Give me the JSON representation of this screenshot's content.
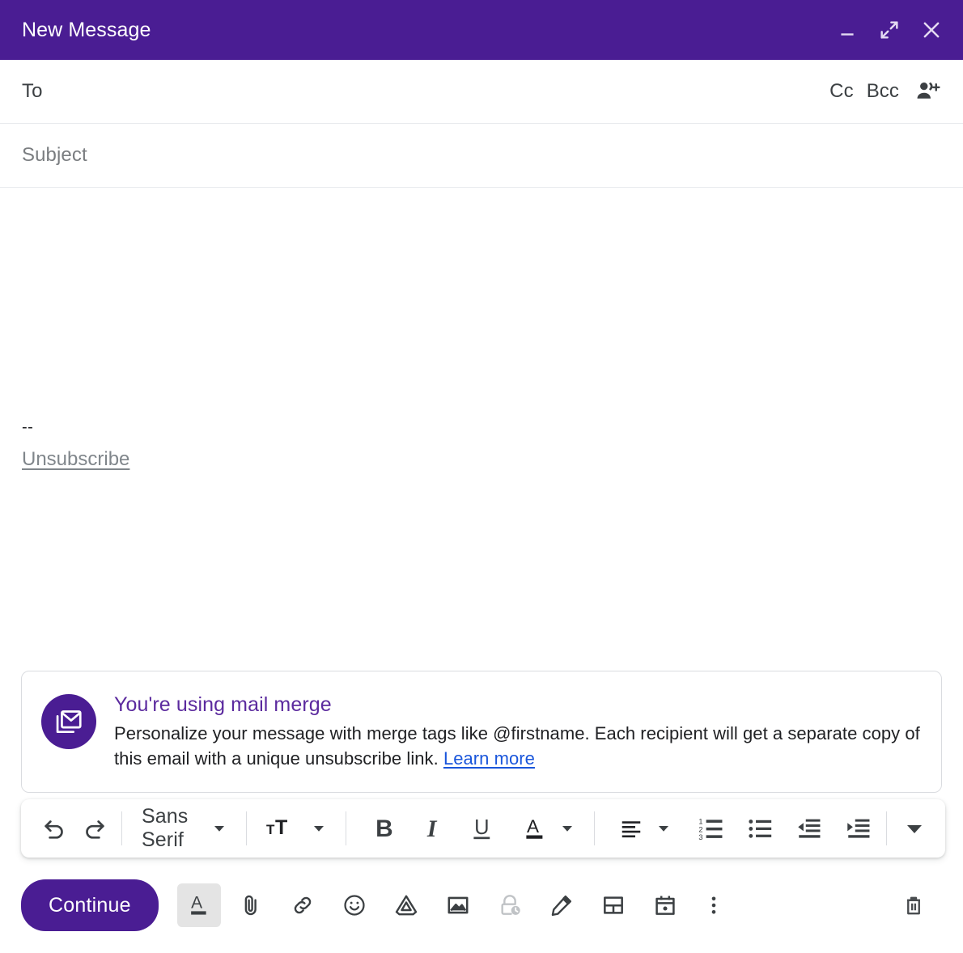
{
  "window": {
    "title": "New Message",
    "controls": [
      {
        "name": "minimize-button",
        "icon": "minimize-icon",
        "label": "Minimize"
      },
      {
        "name": "expand-button",
        "icon": "expand-icon",
        "label": "Full screen"
      },
      {
        "name": "close-button",
        "icon": "close-icon",
        "label": "Save & close"
      }
    ]
  },
  "fields": {
    "to": {
      "label": "To",
      "value": "",
      "placeholder": "To"
    },
    "cc": {
      "label": "Cc"
    },
    "bcc": {
      "label": "Bcc"
    },
    "add_people": {
      "icon": "add-people-icon"
    },
    "subject": {
      "label": "Subject",
      "value": "",
      "placeholder": "Subject"
    }
  },
  "body": {
    "content": "",
    "signature_separator": "--",
    "unsubscribe_label": "Unsubscribe"
  },
  "merge_banner": {
    "icon": "mail-merge-icon",
    "title": "You're using mail merge",
    "description": "Personalize your message with merge tags like @firstname. Each recipient will get a separate copy of this email with a unique unsubscribe link.",
    "link_label": "Learn more",
    "title_color": "#5b2a9e",
    "link_color": "#1a56db"
  },
  "format_toolbar": {
    "undo": {
      "label": "Undo",
      "icon": "undo-icon"
    },
    "redo": {
      "label": "Redo",
      "icon": "redo-icon"
    },
    "font": {
      "name": "Sans Serif",
      "icon": "chevron-down-icon"
    },
    "font_size": {
      "label": "Size",
      "icon": "font-size-icon"
    },
    "bold": {
      "label": "B",
      "icon": "bold-icon"
    },
    "italic": {
      "label": "I",
      "icon": "italic-icon"
    },
    "underline": {
      "label": "U",
      "icon": "underline-icon"
    },
    "text_color": {
      "label": "A",
      "icon": "text-color-icon"
    },
    "align": {
      "label": "Align",
      "icon": "align-left-icon"
    },
    "numbered_list": {
      "label": "Numbered list",
      "icon": "numbered-list-icon"
    },
    "bulleted_list": {
      "label": "Bulleted list",
      "icon": "bulleted-list-icon"
    },
    "indent_less": {
      "label": "Indent less",
      "icon": "indent-decrease-icon"
    },
    "indent_more": {
      "label": "Indent more",
      "icon": "indent-increase-icon"
    },
    "more": {
      "label": "More formatting options",
      "icon": "chevron-down-icon"
    }
  },
  "action_bar": {
    "continue_label": "Continue",
    "buttons": [
      {
        "name": "formatting-options-button",
        "icon": "formatting-options-icon",
        "label": "Formatting options",
        "state": "active"
      },
      {
        "name": "attach-file-button",
        "icon": "paperclip-icon",
        "label": "Attach files",
        "state": "normal"
      },
      {
        "name": "insert-link-button",
        "icon": "link-icon",
        "label": "Insert link",
        "state": "normal"
      },
      {
        "name": "insert-emoji-button",
        "icon": "emoji-icon",
        "label": "Insert emoji",
        "state": "normal"
      },
      {
        "name": "insert-drive-button",
        "icon": "google-drive-icon",
        "label": "Insert files using Drive",
        "state": "normal"
      },
      {
        "name": "insert-photo-button",
        "icon": "image-icon",
        "label": "Insert photo",
        "state": "normal"
      },
      {
        "name": "confidential-mode-button",
        "icon": "lock-clock-icon",
        "label": "Toggle confidential mode",
        "state": "disabled"
      },
      {
        "name": "insert-signature-button",
        "icon": "pen-icon",
        "label": "Insert signature",
        "state": "normal"
      },
      {
        "name": "layout-button",
        "icon": "layout-icon",
        "label": "Layout",
        "state": "normal"
      },
      {
        "name": "calendar-invite-button",
        "icon": "calendar-icon",
        "label": "Set up a time to meet",
        "state": "normal"
      },
      {
        "name": "more-options-button",
        "icon": "more-vertical-icon",
        "label": "More options",
        "state": "normal"
      }
    ],
    "discard": {
      "name": "discard-draft-button",
      "icon": "trash-icon",
      "label": "Discard draft"
    }
  },
  "colors": {
    "header_purple": "#4a1d93",
    "accent_purple": "#5b2a9e",
    "link_blue": "#1a56db",
    "border_gray": "#dadce0",
    "text_dark": "#202124",
    "text_muted": "#80868b"
  }
}
